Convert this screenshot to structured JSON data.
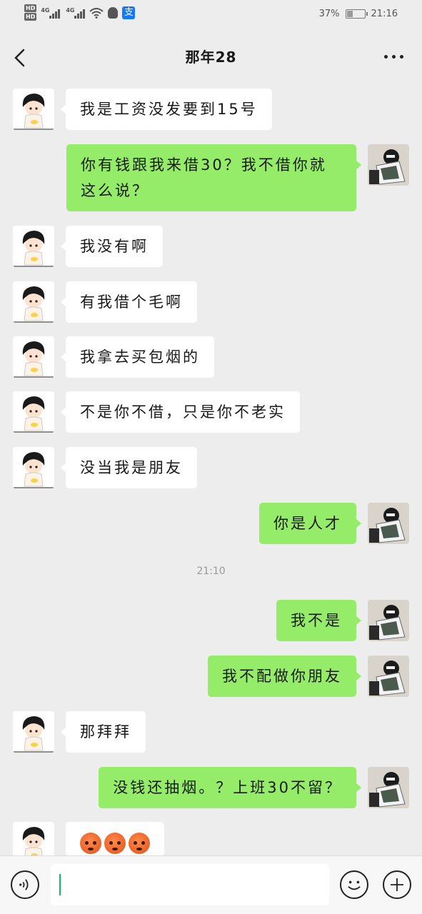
{
  "status_bar": {
    "hd1": "HD",
    "hd2": "HD",
    "net1": "4G",
    "net2": "4G",
    "alipay_glyph": "支",
    "battery_text": "37%",
    "battery_level": 0.37,
    "time": "21:16"
  },
  "header": {
    "title": "那年28"
  },
  "messages": [
    {
      "side": "in",
      "text": "我是工资没发要到15号"
    },
    {
      "side": "out",
      "text": "你有钱跟我来借30？我不借你就这么说？"
    },
    {
      "side": "in",
      "text": "我没有啊"
    },
    {
      "side": "in",
      "text": "有我借个毛啊"
    },
    {
      "side": "in",
      "text": "我拿去买包烟的"
    },
    {
      "side": "in",
      "text": "不是你不借，只是你不老实"
    },
    {
      "side": "in",
      "text": "没当我是朋友"
    },
    {
      "side": "out",
      "text": "你是人才"
    },
    {
      "side": "out",
      "text": "我不是"
    },
    {
      "side": "out",
      "text": "我不配做你朋友"
    },
    {
      "side": "in",
      "text": "那拜拜"
    },
    {
      "side": "out",
      "text": "没钱还抽烟。？上班30不留？"
    },
    {
      "side": "in",
      "text": ""
    }
  ],
  "time_divider": "21:10",
  "colors": {
    "background": "#ededed",
    "outgoing_bubble": "#95ec69",
    "incoming_bubble": "#ffffff",
    "accent": "#07c160"
  },
  "icons": {
    "back": "chevron-left-icon",
    "more": "more-dots-icon",
    "voice": "voice-icon",
    "emoji": "smiley-icon",
    "plus": "plus-icon"
  }
}
